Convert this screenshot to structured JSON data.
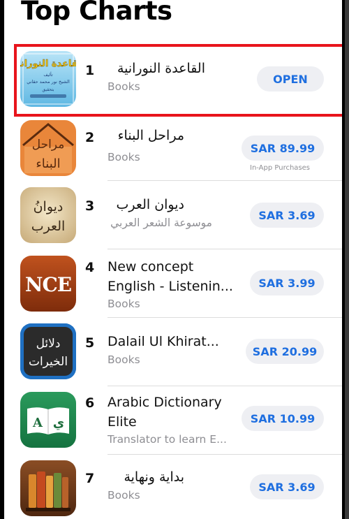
{
  "page": {
    "title": "Top Charts"
  },
  "apps": [
    {
      "rank": "1",
      "name": "القاعدة النورانية",
      "subtitle": "Books",
      "button": "OPEN",
      "note": ""
    },
    {
      "rank": "2",
      "name": "مراحل البناء",
      "subtitle": "Books",
      "button": "SAR 89.99",
      "note": "In-App Purchases"
    },
    {
      "rank": "3",
      "name": "ديوان العرب",
      "subtitle": "موسوعة الشعر العربي",
      "button": "SAR 3.69",
      "note": ""
    },
    {
      "rank": "4",
      "name": "New concept English - Listenin...",
      "subtitle": "Books",
      "button": "SAR 3.99",
      "note": ""
    },
    {
      "rank": "5",
      "name": "Dalail Ul Khirat...",
      "subtitle": "Books",
      "button": "SAR 20.99",
      "note": ""
    },
    {
      "rank": "6",
      "name": "Arabic Dictionary Elite",
      "subtitle": "Translator to learn E...",
      "button": "SAR 10.99",
      "note": ""
    },
    {
      "rank": "7",
      "name": "بداية ونهاية",
      "subtitle": "Books",
      "button": "SAR 3.69",
      "note": ""
    }
  ],
  "icon_text": {
    "app1_title": "القاعدة النورانية",
    "app1_lines": [
      "تأليف",
      "الشيخ نور محمد حقاني",
      "بتحقيق"
    ],
    "app2_words": [
      "مراحل",
      "البناء"
    ],
    "app3_words": [
      "ديوانُ",
      "العرب"
    ],
    "app4_text": "NCE",
    "app5_words": [
      "دلائل",
      "الخيرات"
    ],
    "app6_left": "A",
    "app6_right": "ي"
  },
  "colors": {
    "accent": "#1f6fe0",
    "button_bg": "#eeeff3",
    "highlight": "#e8141c",
    "secondary_text": "#8e8e93"
  }
}
